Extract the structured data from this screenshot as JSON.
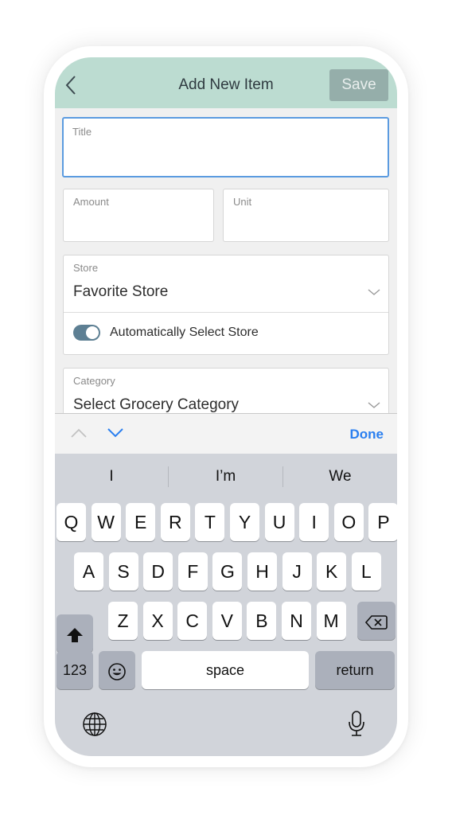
{
  "header": {
    "title": "Add New Item",
    "save_label": "Save",
    "back_icon": "chevron-left-icon",
    "background": "#bcdcd1"
  },
  "form": {
    "title_label": "Title",
    "title_value": "",
    "amount_label": "Amount",
    "unit_label": "Unit",
    "store_label": "Store",
    "store_value": "Favorite Store",
    "auto_store_label": "Automatically Select Store",
    "auto_store_enabled": true,
    "category_label": "Category",
    "category_value": "Select Grocery Category"
  },
  "toolbar": {
    "done_label": "Done",
    "accent": "#2a7ff0"
  },
  "keyboard": {
    "suggestions": [
      "I",
      "I’m",
      "We"
    ],
    "row1": [
      "Q",
      "W",
      "E",
      "R",
      "T",
      "Y",
      "U",
      "I",
      "O",
      "P"
    ],
    "row2": [
      "A",
      "S",
      "D",
      "F",
      "G",
      "H",
      "J",
      "K",
      "L"
    ],
    "row3": [
      "Z",
      "X",
      "C",
      "V",
      "B",
      "N",
      "M"
    ],
    "numbers_label": "123",
    "space_label": "space",
    "return_label": "return",
    "icons": [
      "shift-icon",
      "backspace-icon",
      "emoji-icon",
      "globe-icon",
      "microphone-icon"
    ]
  }
}
